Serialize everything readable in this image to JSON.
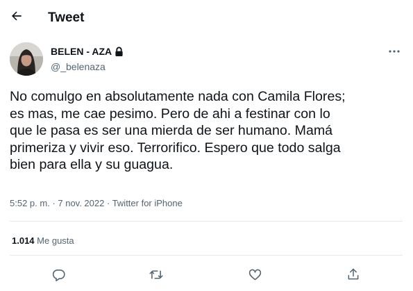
{
  "header": {
    "title": "Tweet",
    "back_icon": "back-arrow-icon"
  },
  "author": {
    "name": "BELEN - AZA",
    "handle": "@_belenaza",
    "protected_icon": "lock-icon"
  },
  "more_icon": "more-options-icon",
  "tweet": {
    "lines": [
      "No comulgo en absolutamente nada con Camila Flores;",
      "es mas, me cae pesimo. Pero de ahi a festinar con lo",
      "que le pasa es ser una mierda de ser humano. Mamá",
      "primeriza y vivir eso. Terrorifico. Espero que todo salga",
      "bien para ella y su guagua."
    ]
  },
  "meta": {
    "time": "5:52 p. m.",
    "separator1": " · ",
    "date": "7 nov. 2022",
    "separator2": " · ",
    "source": "Twitter for iPhone"
  },
  "stats": {
    "likes_count": "1.014",
    "likes_label": "Me gusta"
  },
  "actions": [
    {
      "icon": "reply-icon"
    },
    {
      "icon": "retweet-icon"
    },
    {
      "icon": "like-icon"
    },
    {
      "icon": "share-icon"
    }
  ],
  "colors": {
    "text": "#0f1419",
    "secondary": "#536471",
    "divider": "#e6e9eb"
  }
}
